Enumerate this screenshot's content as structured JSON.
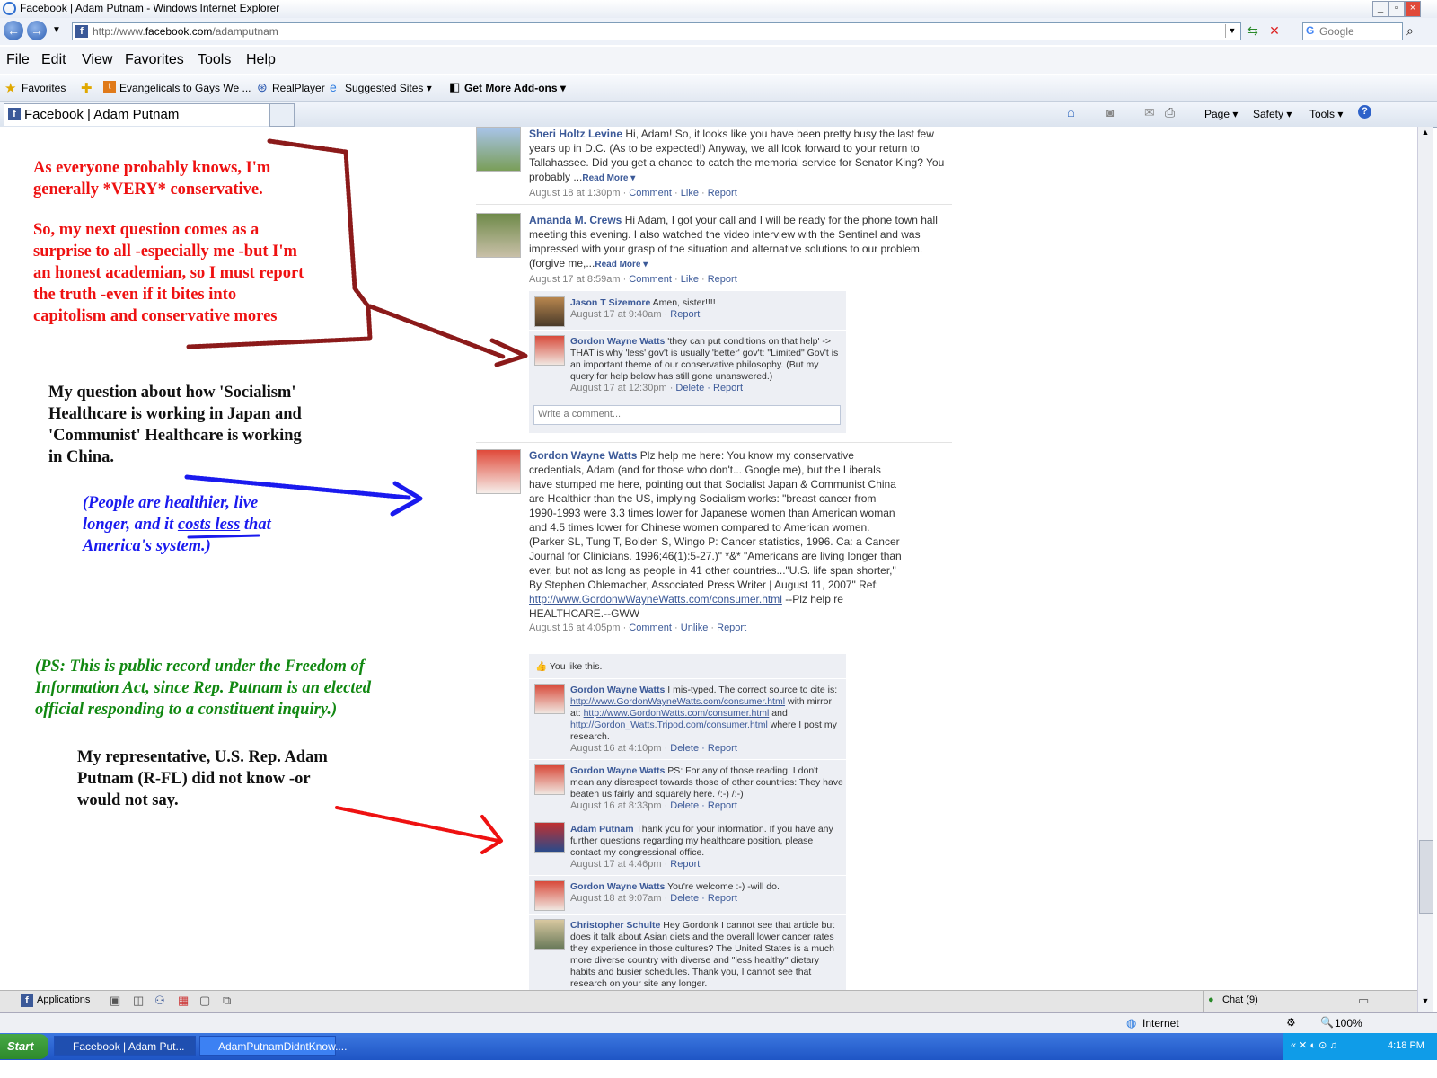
{
  "window": {
    "title": "Facebook | Adam Putnam - Windows Internet Explorer"
  },
  "address": {
    "url_prefix": "http://www.",
    "url_domain": "facebook.com",
    "url_path": "/adamputnam"
  },
  "search": {
    "placeholder": "Google"
  },
  "menu": [
    "File",
    "Edit",
    "View",
    "Favorites",
    "Tools",
    "Help"
  ],
  "favbar": {
    "favorites": "Favorites",
    "items": [
      "Evangelicals to Gays We ...",
      "RealPlayer",
      "Suggested Sites ▾",
      "Get More Add-ons ▾"
    ]
  },
  "tab": {
    "title": "Facebook | Adam Putnam"
  },
  "commands": [
    "Page ▾",
    "Safety ▾",
    "Tools ▾"
  ],
  "annotations": {
    "a1_l1": "As everyone probably knows, I'm",
    "a1_l2": "generally *VERY* conservative.",
    "a2_l1": "So, my next question comes as a",
    "a2_l2": "surprise to all -especially me -but I'm",
    "a2_l3": "an honest academian, so I must report",
    "a2_l4": "the truth -even if it bites into",
    "a2_l5": "capitolism and conservative mores",
    "a3_l1": "My question about how 'Socialism'",
    "a3_l2": "Healthcare is working in Japan and",
    "a3_l3": "'Communist' Healthcare is working",
    "a3_l4": "in China.",
    "a4_l1": "(People are healthier, live",
    "a4_l2a": "longer, and it ",
    "a4_l2b": "costs less",
    "a4_l2c": " that",
    "a4_l3": "America's system.)",
    "a5_l1": "(PS: This is public record under the Freedom of",
    "a5_l2": "Information Act, since Rep. Putnam is an elected",
    "a5_l3": "official responding to a constituent inquiry.)",
    "a6_l1": "My representative, U.S. Rep. Adam",
    "a6_l2": "Putnam (R-FL) did not know -or",
    "a6_l3": "would not say."
  },
  "posts": {
    "p1": {
      "name": "Sheri Holtz Levine",
      "text": " Hi, Adam! So, it looks like you have been pretty busy the last few years up in D.C. (As to be expected!) Anyway, we all look forward to your return to Tallahassee. Did you get a chance to catch the memorial service for Senator King? You probably ...",
      "more": "Read More ▾",
      "time": "August 18 at 1:30pm",
      "a1": "Comment",
      "a2": "Like",
      "a3": "Report"
    },
    "p2": {
      "name": "Amanda M. Crews",
      "text": " Hi Adam, I got your call and I will be ready for the phone town hall meeting this evening. I also watched the video interview with the Sentinel and was impressed with your grasp of the situation and alternative solutions to our problem. (forgive me,...",
      "more": "Read More ▾",
      "time": "August 17 at 8:59am",
      "a1": "Comment",
      "a2": "Like",
      "a3": "Report"
    },
    "p3": {
      "name": "Gordon Wayne Watts",
      "text": " Plz help me here: You know my conservative credentials, Adam (and for those who don't... Google me), but the Liberals have stumped me here, pointing out that Socialist Japan & Communist China are Healthier than the US, implying Socialism works: \"breast cancer from 1990-1993 were 3.3 times lower for Japanese women than American woman and 4.5 times lower for Chinese women compared to American women. (Parker SL, Tung T, Bolden S, Wingo P: Cancer statistics, 1996. Ca: a Cancer Journal for Clinicians. 1996;46(1):5-27.)\" *&* \"Americans are living longer than ever, but not as long as people in 41 other countries...\"U.S. life span shorter,\" By Stephen Ohlemacher, Associated Press Writer | August 11, 2007\" Ref: ",
      "link": "http://www.GordonwWayneWatts.com/consumer.html",
      "tail": " --Plz help re HEALTHCARE.--GWW",
      "time": "August 16 at 4:05pm",
      "a1": "Comment",
      "a2": "Unlike",
      "a3": "Report"
    }
  },
  "comments2": [
    {
      "name": "Jason T Sizemore",
      "text": " Amen, sister!!!!",
      "time": "August 17 at 9:40am",
      "acts": "Report"
    },
    {
      "name": "Gordon Wayne Watts",
      "text": " 'they can put conditions on that help' -> THAT is why 'less' gov't is usually 'better' gov't: \"Limited\" Gov't is an important theme of our conservative philosophy. (But my query for help below has still gone unanswered.)",
      "time": "August 17 at 12:30pm",
      "acts": "Delete · Report"
    }
  ],
  "write_comment": {
    "placeholder": "Write a comment..."
  },
  "likes": "You like this.",
  "comments3": [
    {
      "name": "Gordon Wayne Watts",
      "pre": " I mis-typed. The correct source to cite is: ",
      "l1": "http://www.GordonWayneWatts.com/consumer.html",
      "mid1": " with mirror at: ",
      "l2": "http://www.GordonWatts.com/consumer.html",
      "mid2": " and ",
      "l3": "http://Gordon_Watts.Tripod.com/consumer.html",
      "post": " where I post my research.",
      "time": "August 16 at 4:10pm",
      "acts": "Delete · Report"
    },
    {
      "name": "Gordon Wayne Watts",
      "text": " PS: For any of those reading, I don't mean any disrespect towards those of other countries: They have beaten us fairly and squarely here. /:-) /:-)",
      "time": "August 16 at 8:33pm",
      "acts": "Delete · Report"
    },
    {
      "name": "Adam Putnam",
      "text": " Thank you for your information. If you have any further questions regarding my healthcare position, please contact my congressional office.",
      "time": "August 17 at 4:46pm",
      "acts": "Report"
    },
    {
      "name": "Gordon Wayne Watts",
      "text": " You're welcome :-) -will do.",
      "time": "August 18 at 9:07am",
      "acts": "Delete · Report"
    },
    {
      "name": "Christopher Schulte",
      "text": " Hey Gordonk I cannot see that article but does it talk about Asian diets and the overall lower cancer rates they experience in those cultures? The United States is a much more diverse country with diverse and \"less healthy\" dietary habits and busier schedules. Thank you, I cannot see that research on your site any longer.",
      "time": "",
      "acts": ""
    }
  ],
  "fbbar": {
    "applications": "Applications",
    "chat": "Chat (9)"
  },
  "statusbar": {
    "zone": "Internet",
    "zoom": "100%"
  },
  "taskbar": {
    "start": "Start",
    "t1": "Facebook | Adam Put...",
    "t2": "AdamPutnamDidntKnow....",
    "clock": "4:18 PM"
  },
  "colors": {
    "fb_blue": "#3b5998",
    "annot_red": "#ee1111",
    "annot_blue": "#1a1aee",
    "annot_green": "#118811"
  }
}
